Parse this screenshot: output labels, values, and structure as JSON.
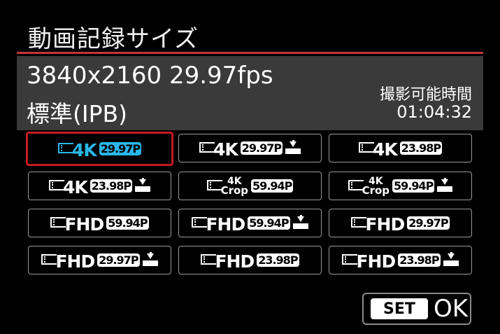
{
  "header": {
    "title": "動画記録サイズ"
  },
  "info": {
    "resolution": "3840x2160 29.97fps",
    "quality": "標準(IPB)",
    "remaining_label": "撮影可能時間",
    "remaining_value": "01:04:32"
  },
  "colors": {
    "accent": "#c61b22",
    "selected": "#2ab7e8",
    "panel": "#3a3a3a"
  },
  "options": [
    {
      "size": "4K",
      "fps": "29.97P",
      "light": false,
      "selected": true
    },
    {
      "size": "4K",
      "fps": "29.97P",
      "light": true,
      "selected": false
    },
    {
      "size": "4K",
      "fps": "23.98P",
      "light": false,
      "selected": false
    },
    {
      "size": "4K",
      "fps": "23.98P",
      "light": true,
      "selected": false
    },
    {
      "size": "4K Crop",
      "fps": "59.94P",
      "light": false,
      "selected": false
    },
    {
      "size": "4K Crop",
      "fps": "59.94P",
      "light": true,
      "selected": false
    },
    {
      "size": "FHD",
      "fps": "59.94P",
      "light": false,
      "selected": false
    },
    {
      "size": "FHD",
      "fps": "59.94P",
      "light": true,
      "selected": false
    },
    {
      "size": "FHD",
      "fps": "29.97P",
      "light": false,
      "selected": false
    },
    {
      "size": "FHD",
      "fps": "29.97P",
      "light": true,
      "selected": false
    },
    {
      "size": "FHD",
      "fps": "23.98P",
      "light": false,
      "selected": false
    },
    {
      "size": "FHD",
      "fps": "23.98P",
      "light": true,
      "selected": false
    }
  ],
  "footer": {
    "set_label": "SET",
    "ok_label": "OK"
  },
  "icons": {
    "movie": "movie-frame-icon",
    "light": "download-tray-icon"
  }
}
